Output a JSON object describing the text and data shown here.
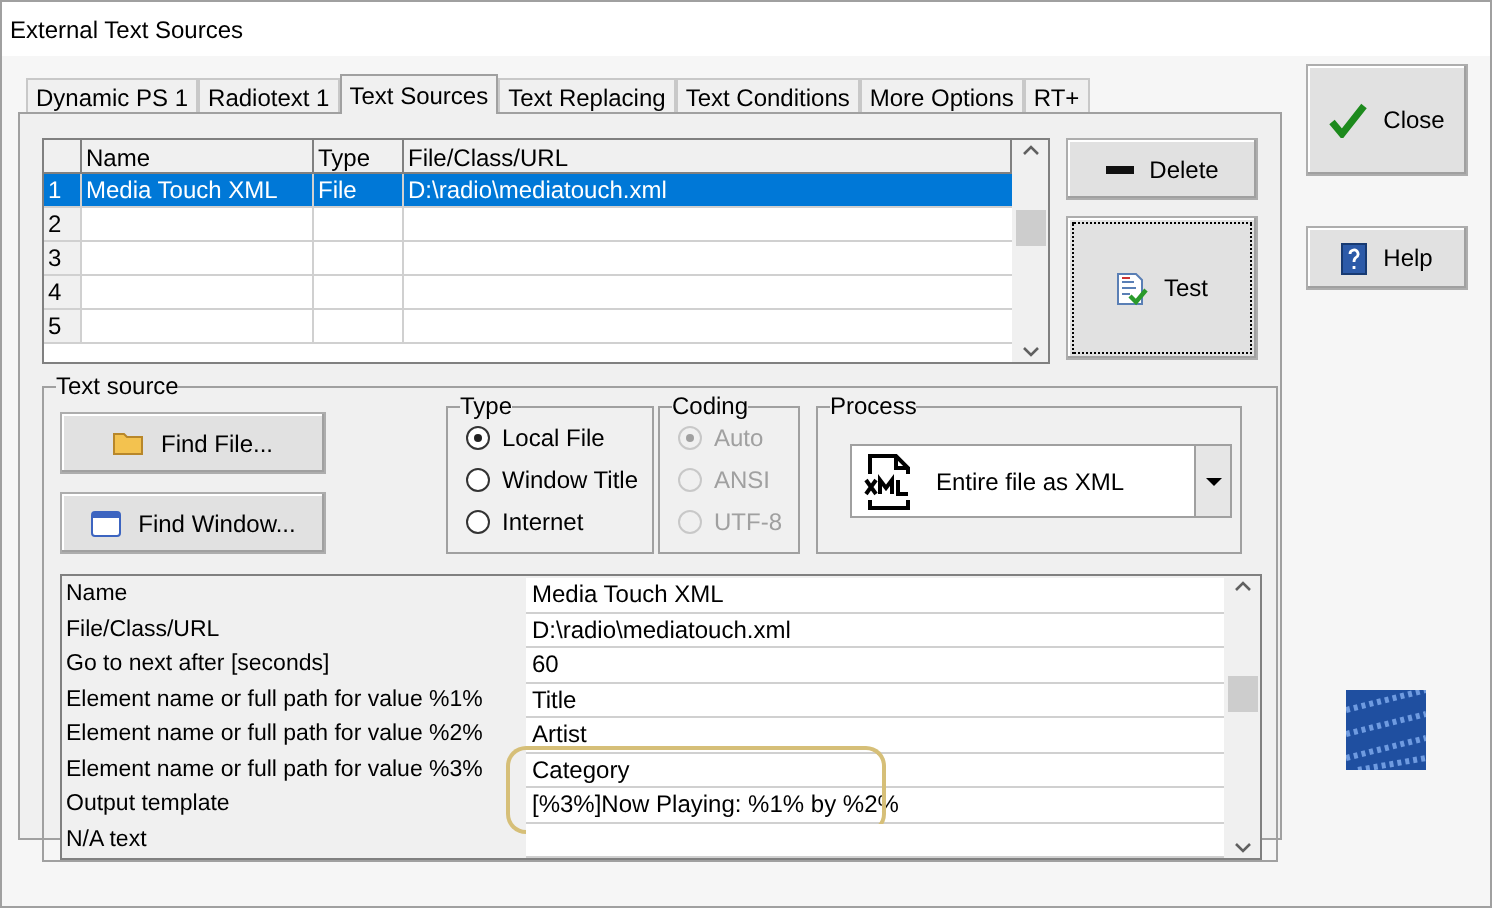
{
  "window": {
    "title": "External Text Sources"
  },
  "tabs": [
    {
      "label": "Dynamic PS 1",
      "selected": false
    },
    {
      "label": "Radiotext 1",
      "selected": false
    },
    {
      "label": "Text Sources",
      "selected": true
    },
    {
      "label": "Text Replacing",
      "selected": false
    },
    {
      "label": "Text Conditions",
      "selected": false
    },
    {
      "label": "More Options",
      "selected": false
    },
    {
      "label": "RT+",
      "selected": false
    }
  ],
  "sources_table": {
    "columns": [
      "Name",
      "Type",
      "File/Class/URL"
    ],
    "rows": [
      {
        "number": "1",
        "name": "Media Touch XML",
        "type": "File",
        "url": "D:\\radio\\mediatouch.xml",
        "selected": true
      },
      {
        "number": "2",
        "name": "",
        "type": "",
        "url": "",
        "selected": false
      },
      {
        "number": "3",
        "name": "",
        "type": "",
        "url": "",
        "selected": false
      },
      {
        "number": "4",
        "name": "",
        "type": "",
        "url": "",
        "selected": false
      },
      {
        "number": "5",
        "name": "",
        "type": "",
        "url": "",
        "selected": false
      }
    ]
  },
  "delete_button": "Delete",
  "test_button": "Test",
  "close_button": "Close",
  "help_button": "Help",
  "text_source": {
    "title": "Text source",
    "find_file_button": "Find File...",
    "find_window_button": "Find Window...",
    "type": {
      "title": "Type",
      "options": [
        {
          "label": "Local File",
          "selected": true,
          "disabled": false
        },
        {
          "label": "Window Title",
          "selected": false,
          "disabled": false
        },
        {
          "label": "Internet",
          "selected": false,
          "disabled": false
        }
      ]
    },
    "coding": {
      "title": "Coding",
      "options": [
        {
          "label": "Auto",
          "selected": true,
          "disabled": true
        },
        {
          "label": "ANSI",
          "selected": false,
          "disabled": true
        },
        {
          "label": "UTF-8",
          "selected": false,
          "disabled": true
        }
      ]
    },
    "process": {
      "title": "Process",
      "value": "Entire file as XML"
    },
    "properties": [
      {
        "label": "Name",
        "value": "Media Touch XML",
        "highlighted": false
      },
      {
        "label": "File/Class/URL",
        "value": "D:\\radio\\mediatouch.xml",
        "highlighted": false
      },
      {
        "label": "Go to next after [seconds]",
        "value": "60",
        "highlighted": false
      },
      {
        "label": "Element name or full path for value %1%",
        "value": "Title",
        "highlighted": false
      },
      {
        "label": "Element name or full path for value %2%",
        "value": "Artist",
        "highlighted": false
      },
      {
        "label": "Element name or full path for value %3%",
        "value": "Category",
        "highlighted": true
      },
      {
        "label": "Output template",
        "value": "[%3%]Now Playing: %1% by %2%",
        "highlighted": true
      },
      {
        "label": "N/A text",
        "highlighted": false
      }
    ]
  }
}
